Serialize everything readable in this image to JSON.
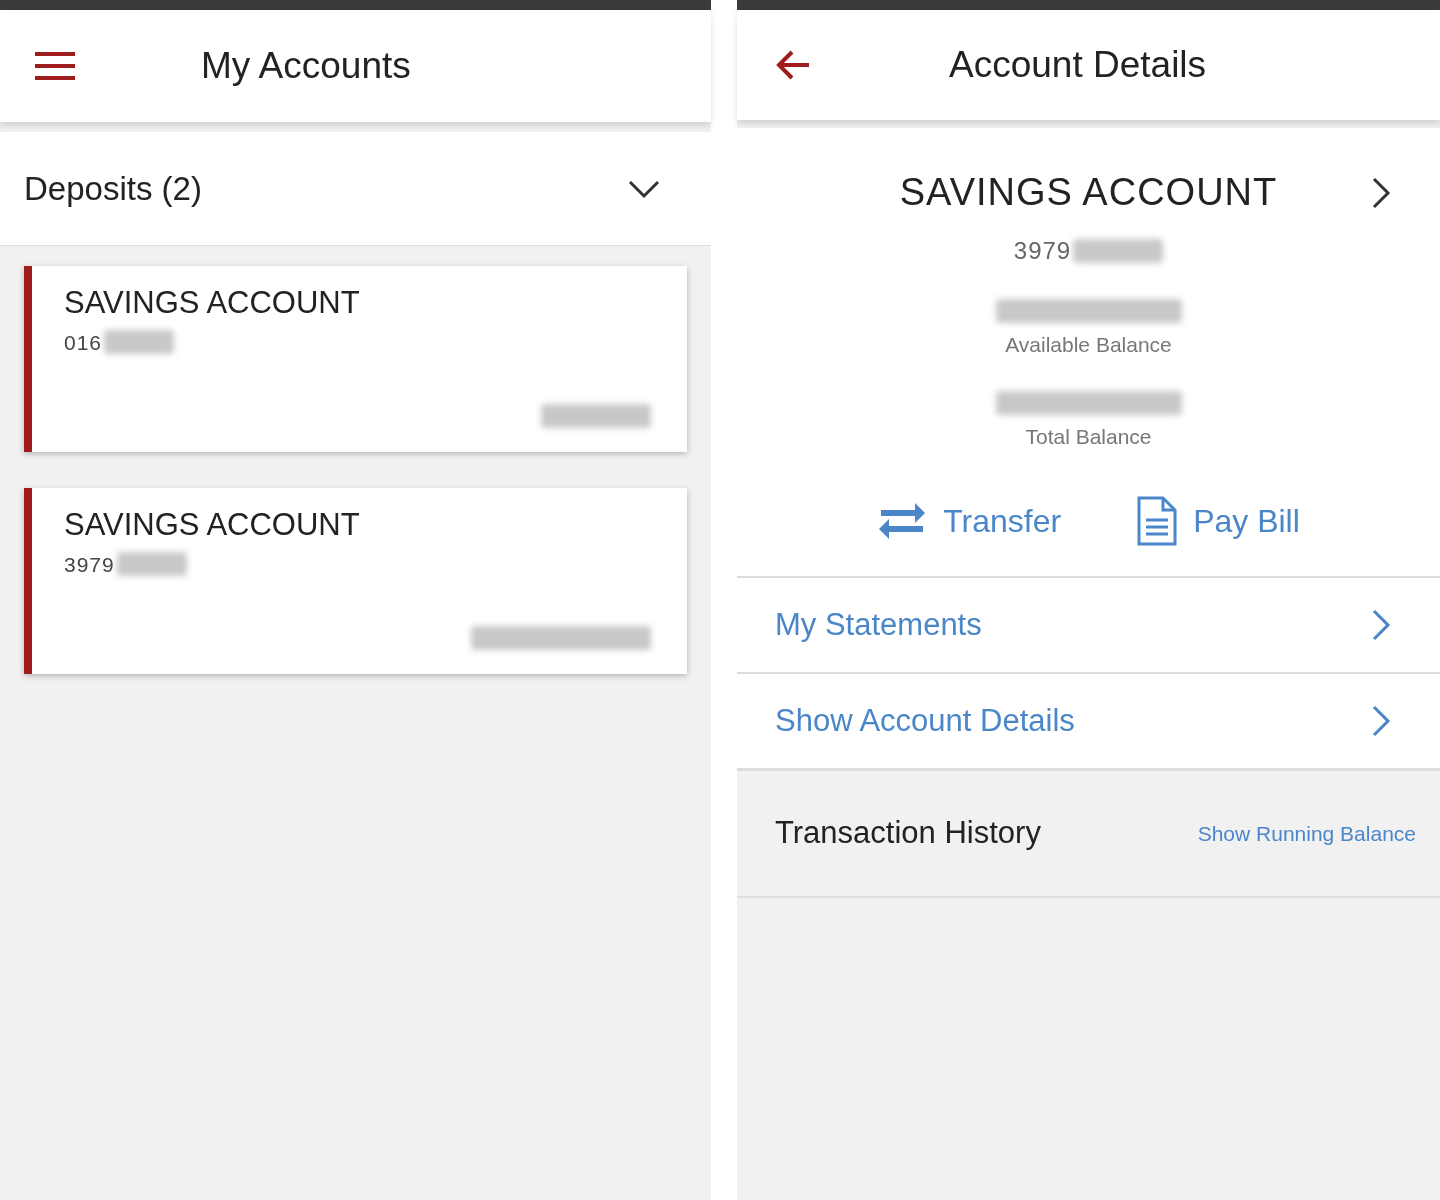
{
  "accounts_screen": {
    "header": {
      "title": "My Accounts"
    },
    "group": {
      "label": "Deposits (2)",
      "expanded": true
    },
    "accounts": [
      {
        "name": "SAVINGS ACCOUNT",
        "number": "016"
      },
      {
        "name": "SAVINGS ACCOUNT",
        "number": "3979"
      }
    ]
  },
  "details_screen": {
    "header": {
      "title": "Account Details"
    },
    "account": {
      "name": "SAVINGS ACCOUNT",
      "number": "3979"
    },
    "balances": [
      {
        "label": "Available Balance"
      },
      {
        "label": "Total Balance"
      }
    ],
    "actions": [
      {
        "kind": "transfer",
        "label": "Transfer"
      },
      {
        "kind": "bill",
        "label": "Pay Bill"
      }
    ],
    "links": [
      "My Statements",
      "Show Account Details"
    ],
    "transactions": {
      "title": "Transaction History",
      "toggle": "Show Running Balance"
    }
  }
}
